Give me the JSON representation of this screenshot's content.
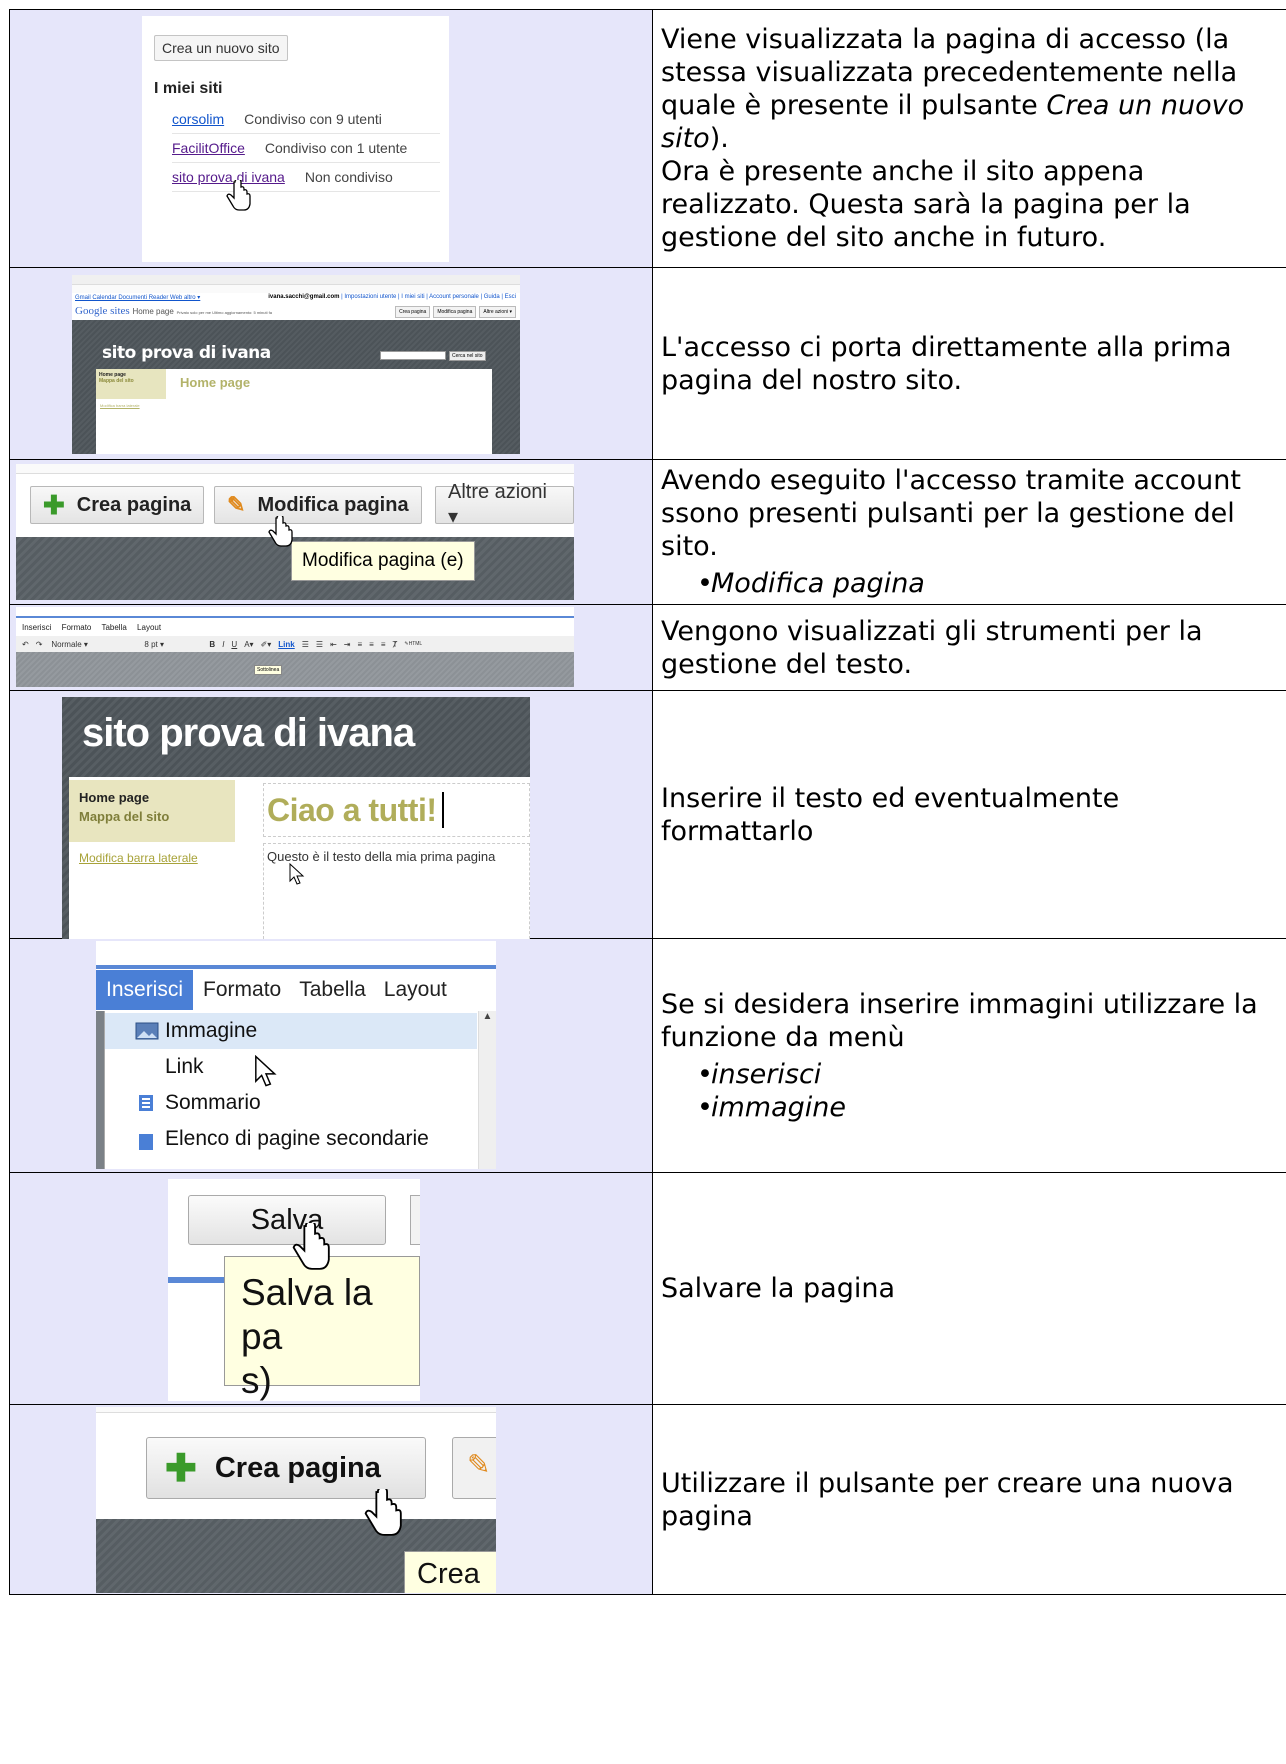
{
  "rows": [
    {
      "text_p1_a": "Viene visualizzata la pagina di accesso (la stessa visualizzata precedentemente nella quale è presente il pulsante ",
      "text_p1_em": "Crea un nuovo sito",
      "text_p1_b": ").",
      "text_p2": "Ora è presente anche il sito appena realizzato. Questa sarà la pagina per la gestione del sito anche in futuro.",
      "shot": {
        "new_site_button": "Crea un nuovo sito",
        "heading": "I miei siti",
        "sites": [
          {
            "name": "corsolim",
            "share": "Condiviso con 9 utenti"
          },
          {
            "name": "FacilitOffice",
            "share": "Condiviso con 1 utente"
          },
          {
            "name": "sito prova di ivana",
            "share": "Non condiviso"
          }
        ]
      }
    },
    {
      "text": "L'accesso ci porta direttamente alla prima pagina del nostro sito.",
      "shot": {
        "top_links": "Gmail  Calendar  Documenti  Reader  Web  altro ▾",
        "account": "ivana.sacchi@gmail.com",
        "account_links": " | Impostazioni utente | I miei siti | Account personale | Guida | Esci",
        "logo": "Google sites",
        "home_page_label": "Home page",
        "privacy": "Privato solo per me  Ultimo aggiornamento: 5 minuti fa",
        "btn_create": "Crea pagina",
        "btn_edit": "Modifica pagina",
        "btn_more": "Altre azioni ▾",
        "site_title": "sito prova di ivana",
        "search_button": "Cerca nel sito",
        "nav_home": "Home page",
        "nav_map": "Mappa del sito",
        "edit_sidebar": "Modifica barra laterale",
        "page_heading": "Home page"
      }
    },
    {
      "text": "Avendo eseguito l'accesso tramite account ssono presenti pulsanti per la gestione del sito.",
      "bullets": [
        "Modifica pagina"
      ],
      "shot": {
        "btn_create": "Crea pagina",
        "btn_edit": "Modifica pagina",
        "btn_more": "Altre azioni ▾",
        "tooltip": "Modifica pagina (e)"
      }
    },
    {
      "text": "Vengono visualizzati gli strumenti per la gestione del testo.",
      "shot": {
        "menu": [
          "Inserisci",
          "Formato",
          "Tabella",
          "Layout"
        ],
        "style_select": "Normale",
        "size_select": "8 pt",
        "link": "Link",
        "html": "HTML",
        "tooltip": "Sottolinea"
      }
    },
    {
      "text": "Inserire il testo ed eventualmente formattarlo",
      "shot": {
        "site_title": "sito prova di ivana",
        "nav_home": "Home page",
        "nav_map": "Mappa del sito",
        "edit_sidebar": "Modifica barra laterale",
        "page_heading": "Ciao a tutti!",
        "body_text": "Questo è il testo della mia prima pagina"
      }
    },
    {
      "text": "Se si desidera inserire immagini utilizzare la funzione da menù",
      "bullets": [
        "inserisci",
        "immagine"
      ],
      "shot": {
        "menu": [
          "Inserisci",
          "Formato",
          "Tabella",
          "Layout"
        ],
        "items": [
          "Immagine",
          "Link",
          "Sommario",
          "Elenco di pagine secondarie"
        ]
      }
    },
    {
      "text": "Salvare la pagina",
      "shot": {
        "button": "Salva",
        "tooltip_l1": "Salva la pa",
        "tooltip_l2": "s)"
      }
    },
    {
      "text": "Utilizzare il pulsante per creare una nuova pagina",
      "shot": {
        "button": "Crea pagina",
        "tooltip": "Crea"
      }
    }
  ]
}
